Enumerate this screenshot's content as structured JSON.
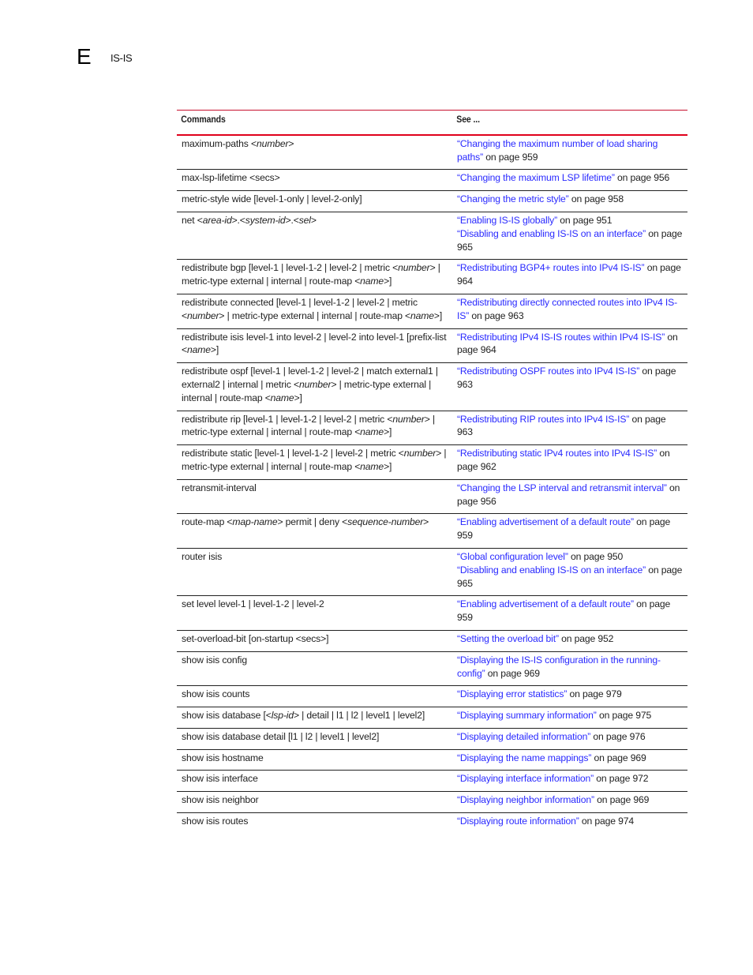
{
  "header": {
    "appendix_letter": "E",
    "section_title": "IS-IS"
  },
  "table": {
    "headers": [
      "Commands",
      "See ..."
    ],
    "link_color": "#2a2aff",
    "rows": [
      {
        "command": [
          {
            "t": "maximum-paths <"
          },
          {
            "t": "number",
            "i": true
          },
          {
            "t": ">"
          }
        ],
        "refs": [
          {
            "link": "“Changing the maximum number of load sharing paths”",
            "page": " on page 959"
          }
        ]
      },
      {
        "command": [
          {
            "t": "max-lsp-lifetime <secs>"
          }
        ],
        "refs": [
          {
            "link": "“Changing the maximum LSP lifetime”",
            "page": " on page 956"
          }
        ]
      },
      {
        "command": [
          {
            "t": "metric-style wide [level-1-only | level-2-only]"
          }
        ],
        "refs": [
          {
            "link": "“Changing the metric style”",
            "page": " on page 958"
          }
        ]
      },
      {
        "command": [
          {
            "t": "net <"
          },
          {
            "t": "area-id",
            "i": true
          },
          {
            "t": ">.<"
          },
          {
            "t": "system-id",
            "i": true
          },
          {
            "t": ">.<"
          },
          {
            "t": "sel",
            "i": true
          },
          {
            "t": ">"
          }
        ],
        "refs": [
          {
            "link": "“Enabling IS-IS globally”",
            "page": " on page 951"
          },
          {
            "link": "“Disabling and enabling IS-IS on an interface”",
            "page": " on page 965"
          }
        ]
      },
      {
        "command": [
          {
            "t": "redistribute bgp [level-1 | level-1-2 | level-2 | metric <"
          },
          {
            "t": "number",
            "i": true
          },
          {
            "t": "> | metric-type external | internal | route-map <"
          },
          {
            "t": "name",
            "i": true
          },
          {
            "t": ">]"
          }
        ],
        "refs": [
          {
            "link": "“Redistributing BGP4+ routes into IPv4 IS-IS”",
            "page": " on page 964"
          }
        ]
      },
      {
        "command": [
          {
            "t": "redistribute connected [level-1 | level-1-2 | level-2 | metric <"
          },
          {
            "t": "number",
            "i": true
          },
          {
            "t": "> | metric-type external | internal | route-map <"
          },
          {
            "t": "name",
            "i": true
          },
          {
            "t": ">]"
          }
        ],
        "refs": [
          {
            "link": "“Redistributing directly connected routes into IPv4 IS-IS”",
            "page": " on page 963"
          }
        ]
      },
      {
        "command": [
          {
            "t": "redistribute isis level-1 into level-2 | level-2 into level-1 [prefix-list <"
          },
          {
            "t": "name",
            "i": true
          },
          {
            "t": ">]"
          }
        ],
        "refs": [
          {
            "link": "“Redistributing IPv4 IS-IS routes within IPv4 IS-IS”",
            "page": " on page 964"
          }
        ]
      },
      {
        "command": [
          {
            "t": "redistribute ospf [level-1 | level-1-2 | level-2 | match external1 | external2 | internal | metric <"
          },
          {
            "t": "number",
            "i": true
          },
          {
            "t": "> | metric-type external | internal | route-map <"
          },
          {
            "t": "name",
            "i": true
          },
          {
            "t": ">]"
          }
        ],
        "refs": [
          {
            "link": "“Redistributing OSPF routes into IPv4 IS-IS”",
            "page": " on page 963"
          }
        ]
      },
      {
        "command": [
          {
            "t": "redistribute rip [level-1 | level-1-2 | level-2 | metric <"
          },
          {
            "t": "number",
            "i": true
          },
          {
            "t": "> | metric-type external | internal | route-map <"
          },
          {
            "t": "name",
            "i": true
          },
          {
            "t": ">]"
          }
        ],
        "refs": [
          {
            "link": "“Redistributing RIP routes into IPv4 IS-IS”",
            "page": " on page 963"
          }
        ]
      },
      {
        "command": [
          {
            "t": "redistribute static [level-1 | level-1-2 | level-2 | metric <"
          },
          {
            "t": "number",
            "i": true
          },
          {
            "t": "> | metric-type external | internal | route-map <"
          },
          {
            "t": "name",
            "i": true
          },
          {
            "t": ">]"
          }
        ],
        "refs": [
          {
            "link": "“Redistributing static IPv4 routes into IPv4 IS-IS”",
            "page": " on page 962"
          }
        ]
      },
      {
        "command": [
          {
            "t": "retransmit-interval"
          }
        ],
        "refs": [
          {
            "link": "“Changing the LSP interval and retransmit interval”",
            "page": " on page 956"
          }
        ]
      },
      {
        "command": [
          {
            "t": "route-map <"
          },
          {
            "t": "map-name",
            "i": true
          },
          {
            "t": "> permit | deny <"
          },
          {
            "t": "sequence-number",
            "i": true
          },
          {
            "t": ">"
          }
        ],
        "refs": [
          {
            "link": "“Enabling advertisement of a default route”",
            "page": " on page 959"
          }
        ]
      },
      {
        "command": [
          {
            "t": "router isis"
          }
        ],
        "refs": [
          {
            "link": "“Global configuration level”",
            "page": " on page 950"
          },
          {
            "link": "“Disabling and enabling IS-IS on an interface”",
            "page": " on page 965"
          }
        ]
      },
      {
        "command": [
          {
            "t": "set level level-1 | level-1-2 | level-2"
          }
        ],
        "refs": [
          {
            "link": "“Enabling advertisement of a default route”",
            "page": " on page 959"
          }
        ]
      },
      {
        "command": [
          {
            "t": "set-overload-bit [on-startup <secs>]"
          }
        ],
        "refs": [
          {
            "link": "“Setting the overload bit”",
            "page": " on page 952"
          }
        ]
      },
      {
        "command": [
          {
            "t": "show isis config"
          }
        ],
        "refs": [
          {
            "link": "“Displaying the IS-IS configuration in the running-config”",
            "page": " on page 969"
          }
        ]
      },
      {
        "command": [
          {
            "t": "show isis counts"
          }
        ],
        "refs": [
          {
            "link": "“Displaying error statistics”",
            "page": " on page 979"
          }
        ]
      },
      {
        "command": [
          {
            "t": "show isis database [<"
          },
          {
            "t": "lsp-id",
            "i": true
          },
          {
            "t": "> | detail | l1 | l2 | level1 | level2]"
          }
        ],
        "refs": [
          {
            "link": "“Displaying summary information”",
            "page": " on page 975"
          }
        ]
      },
      {
        "command": [
          {
            "t": "show isis database detail [l1 | l2 | level1 | level2]"
          }
        ],
        "refs": [
          {
            "link": "“Displaying detailed information”",
            "page": " on page 976"
          }
        ]
      },
      {
        "command": [
          {
            "t": "show isis hostname"
          }
        ],
        "refs": [
          {
            "link": "“Displaying the name mappings”",
            "page": " on page 969"
          }
        ]
      },
      {
        "command": [
          {
            "t": "show isis interface"
          }
        ],
        "refs": [
          {
            "link": "“Displaying interface information”",
            "page": " on page 972"
          }
        ]
      },
      {
        "command": [
          {
            "t": "show isis neighbor"
          }
        ],
        "refs": [
          {
            "link": "“Displaying neighbor information”",
            "page": " on page 969"
          }
        ]
      },
      {
        "command": [
          {
            "t": "show isis routes"
          }
        ],
        "refs": [
          {
            "link": "“Displaying route information”",
            "page": " on page 974"
          }
        ]
      }
    ]
  }
}
